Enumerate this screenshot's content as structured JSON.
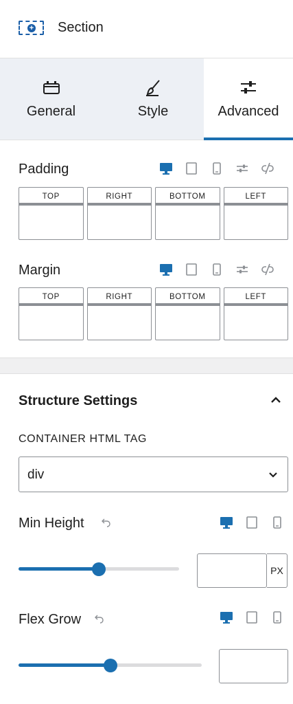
{
  "header": {
    "title": "Section",
    "block_icon": "section-block-icon"
  },
  "tabs": [
    {
      "label": "General",
      "icon": "toolbox-icon",
      "active": false
    },
    {
      "label": "Style",
      "icon": "brush-icon",
      "active": false
    },
    {
      "label": "Advanced",
      "icon": "sliders-icon",
      "active": true
    }
  ],
  "padding": {
    "label": "Padding",
    "boxes": [
      "TOP",
      "RIGHT",
      "BOTTOM",
      "LEFT"
    ]
  },
  "margin": {
    "label": "Margin",
    "boxes": [
      "TOP",
      "RIGHT",
      "BOTTOM",
      "LEFT"
    ]
  },
  "structure": {
    "title": "Structure Settings",
    "container_tag_label": "CONTAINER HTML TAG",
    "container_tag_value": "div",
    "min_height": {
      "label": "Min Height",
      "value": "",
      "unit": "PX",
      "slider_fraction": 0.5
    },
    "flex_grow": {
      "label": "Flex Grow",
      "value": "",
      "slider_fraction": 0.5
    }
  },
  "colors": {
    "accent": "#1b6fb0",
    "muted_icon": "#8c8f94",
    "tab_bg": "#edf0f5"
  }
}
